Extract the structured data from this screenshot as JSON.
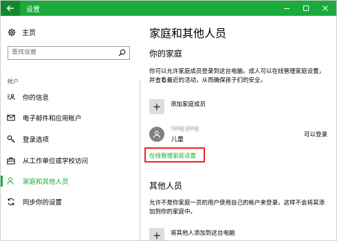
{
  "window": {
    "title": "设置",
    "back_icon": "arrow-left-icon",
    "controls": [
      "minimize-icon",
      "maximize-icon",
      "close-icon"
    ]
  },
  "sidebar": {
    "home_label": "主页",
    "search_placeholder": "查找设置",
    "section_label": "帐户",
    "items": [
      {
        "label": "你的信息",
        "icon": "contact-card-icon"
      },
      {
        "label": "电子邮件和应用帐户",
        "icon": "mail-icon"
      },
      {
        "label": "登录选项",
        "icon": "key-icon"
      },
      {
        "label": "从工作单位或学校访问",
        "icon": "briefcase-icon"
      },
      {
        "label": "家庭和其他人员",
        "icon": "person-icon",
        "active": true
      },
      {
        "label": "同步你的设置",
        "icon": "sync-icon"
      }
    ]
  },
  "main": {
    "title": "家庭和其他人员",
    "family": {
      "heading": "你的家庭",
      "description": "你可以允许家庭成员登录到这台电脑。成人可以在线管理家庭设置，并查看最近的活动，从而确保孩子们的安全。",
      "add_label": "添加家庭成员",
      "member": {
        "name": "ning ping",
        "role": "儿童",
        "status": "可以登录"
      },
      "manage_link": "在线管理家庭设置"
    },
    "others": {
      "heading": "其他人员",
      "description": "允许不是你家庭一员的用户使用自己的帐户来登录。这样不会将其添加到你的家庭中。",
      "add_label": "将其他人添加到这台电脑"
    }
  },
  "colors": {
    "accent": "#1aab3c",
    "highlight_border": "#ff1c1c"
  }
}
